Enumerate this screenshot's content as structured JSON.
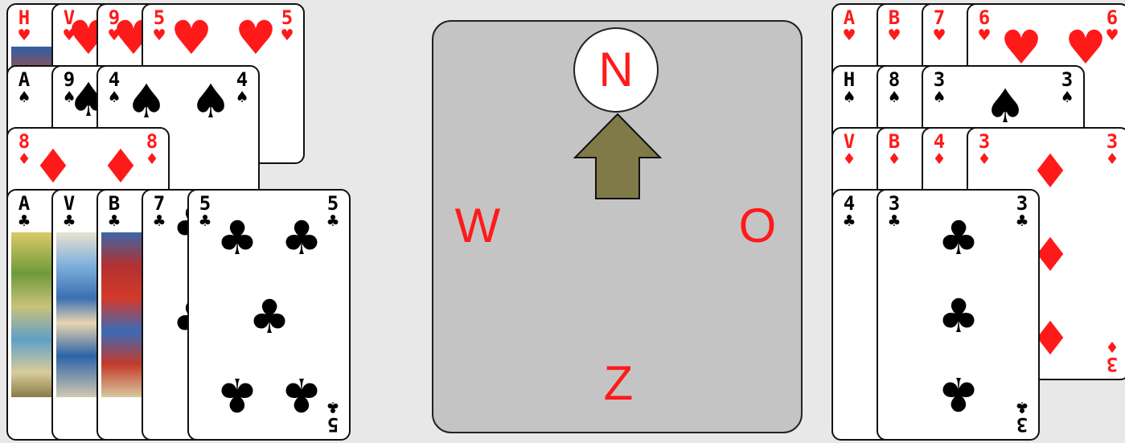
{
  "table": {
    "north": "N",
    "west": "W",
    "east": "O",
    "south": "Z",
    "turn_indicator": "arrow pointing to N"
  },
  "colors": {
    "red": "#ff1a1a",
    "black": "#000000",
    "table": "#c4c4c4",
    "arrow": "#807a48",
    "background": "#e8e8e8"
  },
  "west_hand": {
    "hearts": [
      "H",
      "V",
      "9",
      "5"
    ],
    "spades": [
      "A",
      "9",
      "4"
    ],
    "diamonds": [
      "8"
    ],
    "clubs": [
      "A",
      "V",
      "B",
      "7",
      "5"
    ]
  },
  "east_hand": {
    "hearts": [
      "A",
      "B",
      "7",
      "6"
    ],
    "spades": [
      "H",
      "8",
      "3"
    ],
    "diamonds": [
      "V",
      "B",
      "4",
      "3"
    ],
    "clubs": [
      "4",
      "3"
    ]
  },
  "suits": {
    "hearts": "♥",
    "spades": "♠",
    "diamonds": "♦",
    "clubs": "♣"
  }
}
